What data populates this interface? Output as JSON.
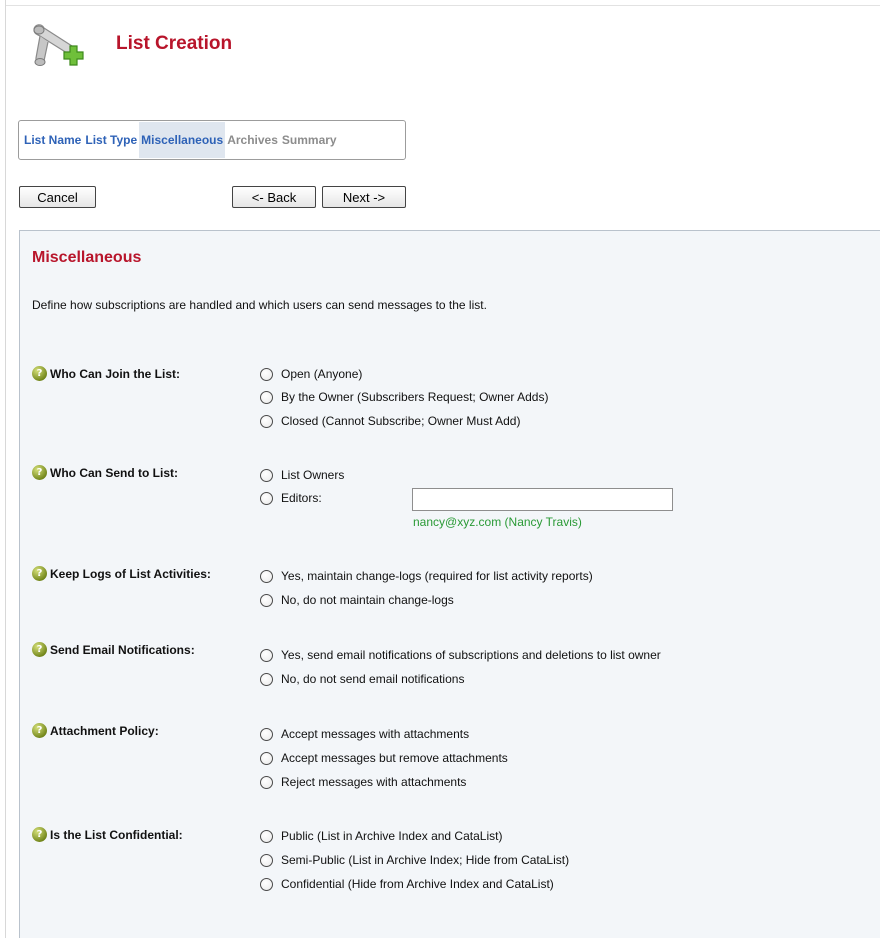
{
  "header": {
    "title": "List Creation",
    "logo_icon": "scroll-add-icon"
  },
  "wizard": {
    "steps": [
      {
        "label": "List Name",
        "state": "done"
      },
      {
        "label": "List Type",
        "state": "done"
      },
      {
        "label": "Miscellaneous",
        "state": "active"
      },
      {
        "label": "Archives",
        "state": "pending"
      },
      {
        "label": "Summary",
        "state": "pending"
      }
    ]
  },
  "buttons": {
    "cancel": "Cancel",
    "back": "<- Back",
    "next": "Next ->"
  },
  "panel": {
    "title": "Miscellaneous",
    "description": "Define how subscriptions are handled and which users can send messages to the list.",
    "help_glyph": "?",
    "questions": [
      {
        "label": "Who Can Join the List:",
        "options": [
          "Open (Anyone)",
          "By the Owner (Subscribers Request; Owner Adds)",
          "Closed (Cannot Subscribe; Owner Must Add)"
        ]
      },
      {
        "label": "Who Can Send to List:",
        "options": [
          "List Owners",
          "Editors:"
        ],
        "editors_value": "",
        "editor_hint": "nancy@xyz.com (Nancy Travis)"
      },
      {
        "label": "Keep Logs of List Activities:",
        "options": [
          "Yes, maintain change-logs (required for list activity reports)",
          "No, do not maintain change-logs"
        ]
      },
      {
        "label": "Send Email Notifications:",
        "options": [
          "Yes, send email notifications of subscriptions and deletions to list owner",
          "No, do not send email notifications"
        ]
      },
      {
        "label": "Attachment Policy:",
        "options": [
          "Accept messages with attachments",
          "Accept messages but remove attachments",
          "Reject messages with attachments"
        ]
      },
      {
        "label": "Is the List Confidential:",
        "options": [
          "Public (List in Archive Index and CataList)",
          "Semi-Public (List in Archive Index; Hide from CataList)",
          "Confidential (Hide from Archive Index and CataList)"
        ]
      }
    ]
  },
  "colors": {
    "title_red": "#b8152b",
    "step_blue": "#2e62b7",
    "step_grey": "#8c8c8c",
    "hint_green": "#2a9a36",
    "panel_bg": "#f3f6f9"
  }
}
